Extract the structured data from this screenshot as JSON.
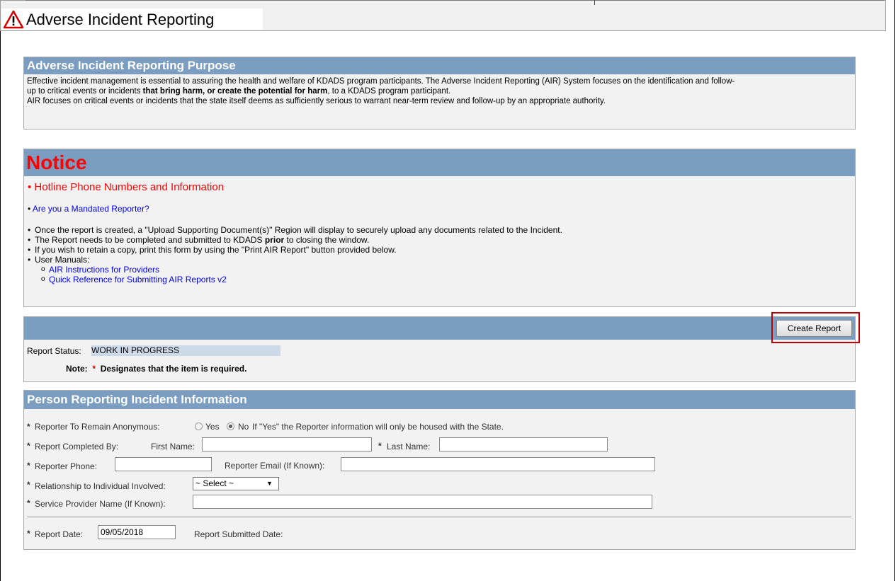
{
  "window": {
    "title": "Adverse Incident Reporting"
  },
  "purpose": {
    "heading": "Adverse Incident Reporting Purpose",
    "para1_a": "Effective incident management is essential to assuring the health and welfare of KDADS program participants. The Adverse Incident Reporting (AIR) System focuses on the identification and follow-",
    "para1_b_pre": "up to critical events or incidents ",
    "para1_b_bold": "that bring harm, or create the potential for harm",
    "para1_b_post": ", to a KDADS program participant.",
    "para2": "AIR focuses on critical events or incidents that the state itself deems as sufficiently serious to warrant near-term review and follow-up by an appropriate authority."
  },
  "notice": {
    "heading": "Notice",
    "hotline": "Hotline Phone Numbers and Information",
    "mandated": "Are you a Mandated Reporter?",
    "item1": "Once the report is created, a \"Upload Supporting Document(s)\" Region will display to securely upload any documents related to the Incident.",
    "item2_pre": "The Report needs to be completed and submitted to KDADS ",
    "item2_bold": "prior",
    "item2_post": " to closing the window.",
    "item3": "If you wish to retain a copy, print this form by using the \"Print AIR Report\" button provided below.",
    "item4": "User Manuals:",
    "manual1": "AIR Instructions for Providers",
    "manual2": "Quick Reference for Submitting AIR Reports v2"
  },
  "report": {
    "create_button": "Create Report",
    "status_label": "Report Status:",
    "status_value": "WORK IN PROGRESS",
    "note_label": "Note:",
    "note_star": "*",
    "note_text": "Designates that the item is required."
  },
  "person": {
    "heading": "Person Reporting Incident Information",
    "star": "*",
    "anon_label": "Reporter To Remain Anonymous:",
    "anon_yes": "Yes",
    "anon_no": "No",
    "anon_selected": "No",
    "anon_hint": "If \"Yes\" the Reporter information will only be housed with the State.",
    "completed_by": "Report Completed By:",
    "first_name": "First Name:",
    "last_name": "Last Name:",
    "phone": "Reporter Phone:",
    "email": "Reporter Email (If Known):",
    "relationship": "Relationship to Individual Involved:",
    "relationship_value": "~ Select ~",
    "provider": "Service Provider Name (If Known):",
    "report_date_label": "Report Date:",
    "report_date_value": "09/05/2018",
    "submitted_label": "Report Submitted Date:"
  },
  "colors": {
    "header_bar": "#7b9dc2",
    "notice_red": "#ff0000",
    "link_blue": "#0000ee",
    "highlight": "#c00000"
  }
}
